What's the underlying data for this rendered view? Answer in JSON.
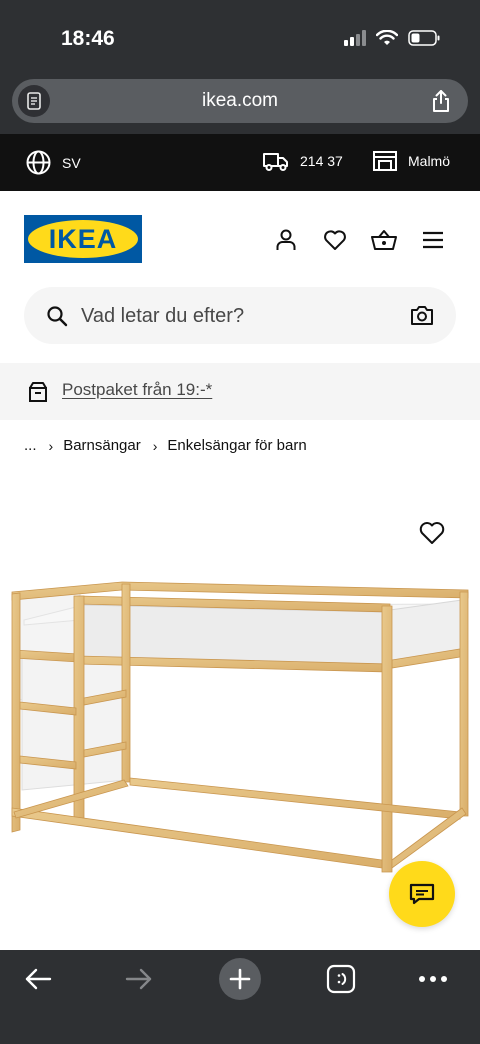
{
  "status_bar": {
    "time": "18:46"
  },
  "browser": {
    "url": "ikea.com"
  },
  "top_strip": {
    "language": "SV",
    "zip_code": "214 37",
    "store": "Malmö"
  },
  "header": {
    "logo_text": "IKEA"
  },
  "search": {
    "placeholder": "Vad letar du efter?"
  },
  "promo": {
    "text": "Postpaket från 19:-*"
  },
  "breadcrumb": {
    "ellipsis": "...",
    "separator": "›",
    "items": [
      "Barnsängar",
      "Enkelsängar för barn"
    ]
  },
  "colors": {
    "ikea_blue": "#0058a3",
    "ikea_yellow": "#ffda1a",
    "browser_chrome": "#2e3033",
    "top_strip": "#111111",
    "light_gray": "#f5f5f5"
  },
  "icons": {
    "header": [
      "user-icon",
      "heart-icon",
      "basket-icon",
      "menu-icon"
    ],
    "bottom_toolbar": [
      "back-arrow-icon",
      "forward-arrow-icon",
      "new-tab-plus-icon",
      "tabs-icon",
      "more-icon"
    ]
  }
}
